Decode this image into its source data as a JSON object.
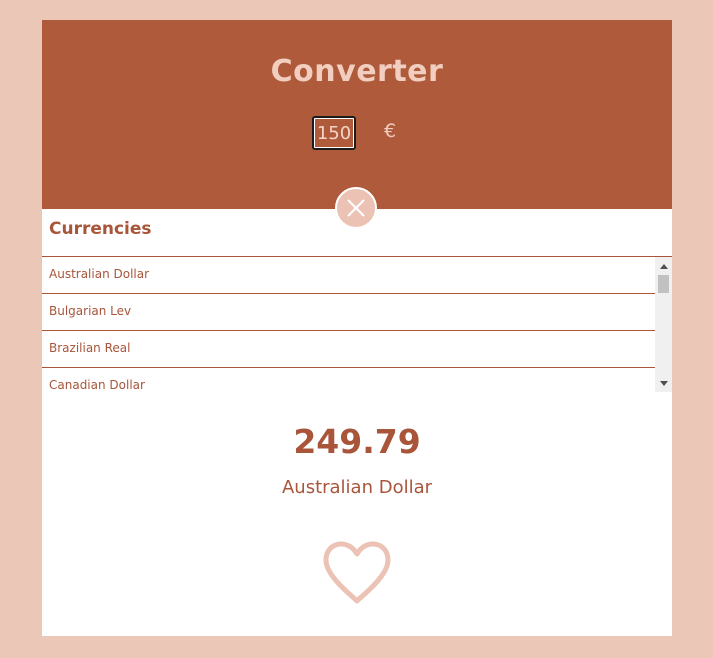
{
  "header": {
    "title": "Converter",
    "amount_value": "150",
    "currency_symbol": "€"
  },
  "currencies": {
    "label": "Currencies",
    "items": [
      {
        "label": "Australian Dollar"
      },
      {
        "label": "Bulgarian Lev"
      },
      {
        "label": "Brazilian Real"
      },
      {
        "label": "Canadian Dollar"
      }
    ]
  },
  "result": {
    "value": "249.79",
    "currency": "Australian Dollar"
  },
  "icons": {
    "close": "close-icon",
    "favorite": "heart-icon",
    "scroll_up": "arrow-up-icon",
    "scroll_down": "arrow-down-icon"
  },
  "colors": {
    "page_background": "#ebc7b8",
    "header_background": "#af5b3b",
    "accent_text": "#a8553a",
    "light_accent": "#ebc2b4"
  }
}
